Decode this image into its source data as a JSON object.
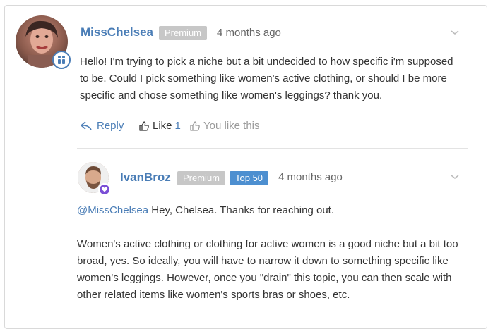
{
  "comment": {
    "author": "MissChelsea",
    "badge": "Premium",
    "time": "4 months ago",
    "text": "Hello! I'm trying to pick a niche but a bit undecided to how specific i'm supposed to be. Could I pick something like women's active clothing, or should I be more specific and chose something like women's leggings? thank you.",
    "actions": {
      "reply": "Reply",
      "like": "Like",
      "like_count": "1",
      "you_like": "You like this"
    }
  },
  "reply": {
    "author": "IvanBroz",
    "badge_premium": "Premium",
    "badge_top": "Top 50",
    "time": "4 months ago",
    "mention": "@MissChelsea",
    "line1": "Hey, Chelsea. Thanks for reaching out.",
    "paragraph": "Women's active clothing or clothing for active women is a good niche but a bit too broad, yes. So ideally, you will have to narrow it down to something specific like women's leggings. However, once you \"drain\" this topic, you can then scale with other related items like women's sports bras or shoes, etc."
  },
  "colors": {
    "link": "#4a7db6",
    "premium_tag": "#c7c7c7",
    "top_tag": "#4d8fd0",
    "badge_purple": "#7b4fd6"
  },
  "icons": {
    "user_badge": "users-icon",
    "reply": "reply-arrow-icon",
    "like": "thumbs-up-icon",
    "menu": "chevron-down-icon",
    "reply_badge": "heart-icon"
  }
}
